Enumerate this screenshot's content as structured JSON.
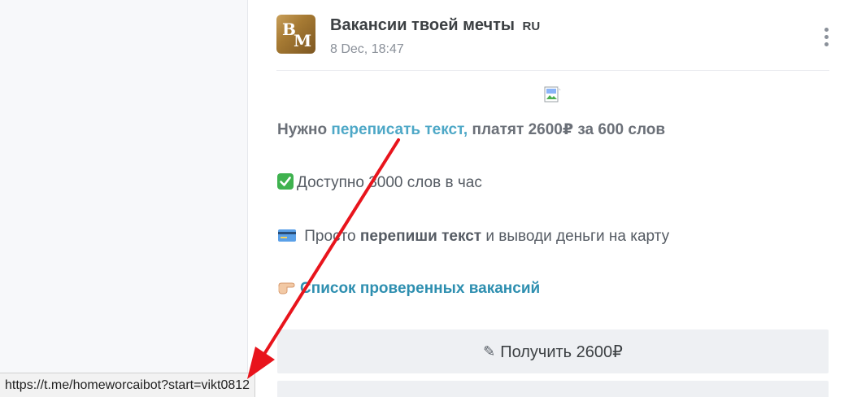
{
  "channel": {
    "name": "Вакансии твоей мечты",
    "lang_badge": "RU",
    "date": "8 Dec, 18:47",
    "avatar_letters": {
      "first": "B",
      "second": "M"
    }
  },
  "post": {
    "line1": {
      "before": "Нужно ",
      "link": "переписать текст,",
      "after": " платят 2600₽ за 600 слов"
    },
    "line2": {
      "emoji": "check-mark-button-icon",
      "text": "Доступно 3000 слов в час"
    },
    "line3": {
      "emoji": "credit-card-icon",
      "before": " Просто ",
      "bold": "перепиши текст",
      "after": " и выводи деньги на карту"
    },
    "line4": {
      "emoji": "pointing-hand-icon",
      "link": "Список проверенных вакансий"
    }
  },
  "buttons": {
    "primary": {
      "icon": "pencil-icon",
      "label": "Получить 2600₽"
    }
  },
  "status_bar": {
    "url": "https://t.me/homeworcaibot?start=vikt0812"
  },
  "colors": {
    "link": "#4ea8c7",
    "bold_link": "#2e8fb0",
    "arrow": "#e8141c",
    "button_bg": "#eef0f3"
  }
}
